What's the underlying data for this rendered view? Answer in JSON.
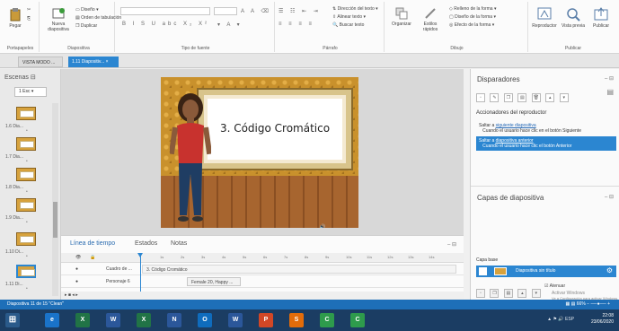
{
  "ribbon": {
    "groups": [
      {
        "label": "Portapapeles",
        "buttons": [
          "Pegar"
        ]
      },
      {
        "label": "Diapositiva",
        "buttons": [
          "Nueva diapositiva",
          "Diseño",
          "Orden de tabulación",
          "Duplicar"
        ]
      },
      {
        "label": "Tipo de fuente",
        "buttons": []
      },
      {
        "label": "Párrafo",
        "buttons": [
          "Dirección del texto",
          "Alinear texto",
          "Buscar texto"
        ]
      },
      {
        "label": "Dibujo",
        "buttons": [
          "Organizar",
          "Estilos rápidos",
          "Relleno de la forma",
          "Diseño de la forma",
          "Efecto de la forma"
        ]
      },
      {
        "label": "Publicar",
        "buttons": [
          "Reproductor",
          "Vista previa",
          "Publicar"
        ]
      }
    ]
  },
  "tabs": [
    {
      "label": "VISTA MODO ..."
    },
    {
      "label": "1.11 Diapositiv..."
    }
  ],
  "scenes": {
    "title": "Escenas",
    "select": "1 Esc",
    "items": [
      {
        "label": "1.6 Dia..."
      },
      {
        "label": "1.7 Dia..."
      },
      {
        "label": "1.8 Dia..."
      },
      {
        "label": "1.9 Dia..."
      },
      {
        "label": "1.10 Di..."
      },
      {
        "label": "1.11 Di..."
      }
    ]
  },
  "slide": {
    "title": "3. Código Cromático"
  },
  "timeline": {
    "tabs": [
      "Línea de tiempo",
      "Estados",
      "Notas"
    ],
    "ticks": [
      "1s",
      "2s",
      "3s",
      "4s",
      "5s",
      "6s",
      "7s",
      "8s",
      "9s",
      "10s",
      "11s",
      "12s",
      "13s",
      "14s"
    ],
    "rows": [
      {
        "name": "Cuadro de ...",
        "bar": "3. Código Cromático"
      },
      {
        "name": "Personaje 6",
        "bar": "Female 20, Happy ..."
      }
    ]
  },
  "triggers": {
    "title": "Disparadores",
    "subtitle": "Accionadores del reproductor",
    "items": [
      {
        "line1": "Saltar a ",
        "link": "siguiente diapositiva",
        "line2": "Cuando el usuario hace clic en el botón Siguiente",
        "selected": false
      },
      {
        "line1": "Saltar a ",
        "link": "diapositiva anterior",
        "line2": "Cuando el usuario hace clic el botón Anterior",
        "selected": true
      }
    ]
  },
  "layers": {
    "title": "Capas de diapositiva",
    "base_label": "Capa base",
    "layer_name": "Diapositiva sin título",
    "dim_label": "Atenuar",
    "activate_text": "Activar Windows",
    "activate_sub": "Ve a Configuración para activar Windows."
  },
  "status": {
    "left": "Diapositiva 11 de 15   \"Clean\"",
    "zoom": "66%"
  },
  "taskbar": {
    "apps": [
      {
        "name": "edge",
        "glyph": "e",
        "color": "#1a73c9"
      },
      {
        "name": "excel",
        "glyph": "X",
        "color": "#217346"
      },
      {
        "name": "word",
        "glyph": "W",
        "color": "#2b579a"
      },
      {
        "name": "excel2",
        "glyph": "X",
        "color": "#217346"
      },
      {
        "name": "onenote",
        "glyph": "N",
        "color": "#2b579a"
      },
      {
        "name": "outlook",
        "glyph": "O",
        "color": "#0f6cbd"
      },
      {
        "name": "word2",
        "glyph": "W",
        "color": "#2b579a"
      },
      {
        "name": "powerpoint",
        "glyph": "P",
        "color": "#d24726"
      },
      {
        "name": "app9",
        "glyph": "S",
        "color": "#e36c0a"
      },
      {
        "name": "app10",
        "glyph": "C",
        "color": "#2e9b4c"
      },
      {
        "name": "app11",
        "glyph": "C",
        "color": "#2e9b4c"
      }
    ],
    "lang": "ESP",
    "time": "22:08",
    "date": "23/06/2020"
  },
  "colors": {
    "accent": "#2b86d1",
    "taskbar": "#1b3d63",
    "status": "#1e6fb8"
  }
}
